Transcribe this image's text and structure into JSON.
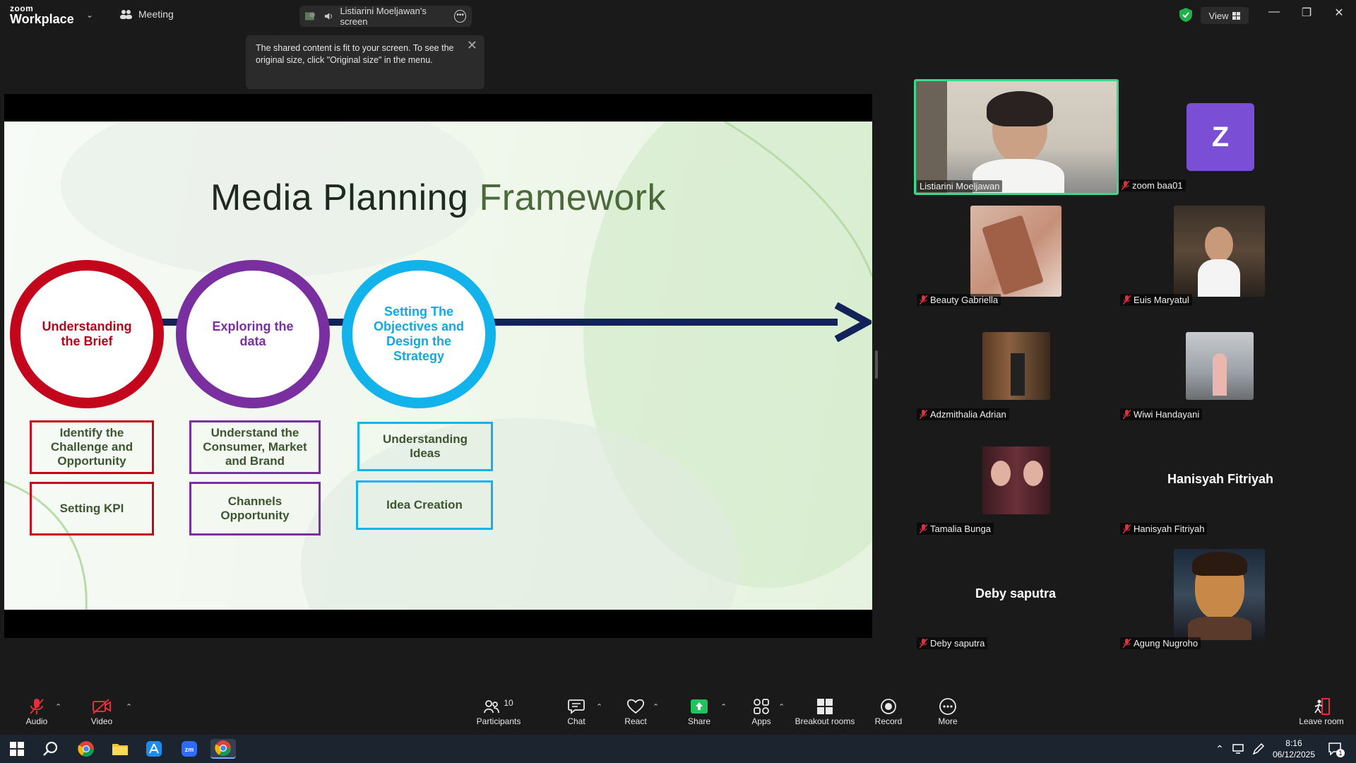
{
  "app": {
    "brand_top": "zoom",
    "brand_bottom": "Workplace",
    "meeting_label": "Meeting",
    "view_label": "View"
  },
  "share_pill": {
    "label": "Listiarini Moeljawan's screen"
  },
  "notice": {
    "text": "The shared content is fit to your screen. To see the original size, click \"Original size\" in the menu."
  },
  "slide": {
    "title_main": "Media Planning",
    "title_accent": "Framework",
    "circles": [
      "Understanding the Brief",
      "Exploring the data",
      "Setting The Objectives and Design the Strategy"
    ],
    "boxes_row1": [
      "Identify the Challenge and Opportunity",
      "Understand the Consumer, Market and Brand",
      "Understanding Ideas"
    ],
    "boxes_row2": [
      "Setting KPI",
      "Channels Opportunity",
      "Idea Creation"
    ]
  },
  "participants": [
    {
      "name": "Listiarini Moeljawan",
      "muted": false
    },
    {
      "name": "zoom baa01",
      "muted": true,
      "avatar_letter": "Z"
    },
    {
      "name": "Beauty Gabriella",
      "muted": true
    },
    {
      "name": "Euis Maryatul",
      "muted": true
    },
    {
      "name": "Adzmithalia Adrian",
      "muted": true
    },
    {
      "name": "Wiwi Handayani",
      "muted": true
    },
    {
      "name": "Tamalia Bunga",
      "muted": true
    },
    {
      "name": "Hanisyah Fitriyah",
      "muted": true
    },
    {
      "name": "Deby saputra",
      "muted": true
    },
    {
      "name": "Agung Nugroho",
      "muted": true
    }
  ],
  "toolbar": {
    "audio": "Audio",
    "video": "Video",
    "participants": "Participants",
    "participants_count": "10",
    "chat": "Chat",
    "react": "React",
    "share": "Share",
    "apps": "Apps",
    "breakout": "Breakout rooms",
    "record": "Record",
    "more": "More",
    "leave": "Leave room"
  },
  "taskbar": {
    "time": "8:16",
    "date": "06/12/2025",
    "notification_count": "1"
  },
  "colors": {
    "red": "#c4061c",
    "purple": "#7a2fa0",
    "blue": "#12b3ea",
    "navy": "#12235a",
    "share_green": "#22c35e",
    "speaker_border": "#3dd68c"
  }
}
